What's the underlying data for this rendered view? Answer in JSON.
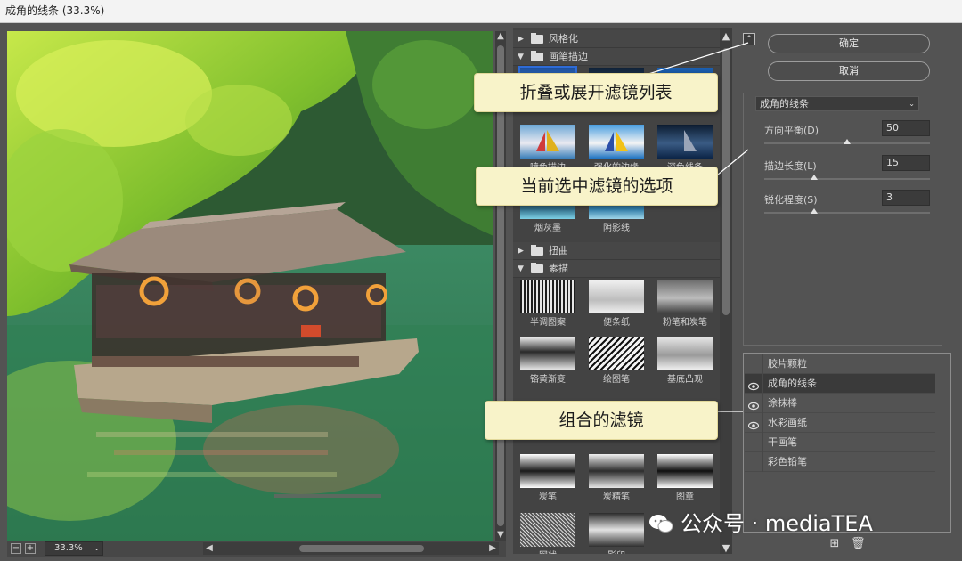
{
  "window": {
    "title": "成角的线条 (33.3%)"
  },
  "preview": {
    "zoom": "33.3%"
  },
  "gallery": {
    "categories": [
      {
        "label": "风格化",
        "expanded": false
      },
      {
        "label": "画笔描边",
        "expanded": true
      },
      {
        "label": "扭曲",
        "expanded": false
      },
      {
        "label": "素描",
        "expanded": true
      }
    ],
    "brush_thumbs": [
      "喷色描边",
      "强化的边缘",
      "深色线条",
      "烟灰墨",
      "阴影线"
    ],
    "sketch_thumbs": [
      "半调图案",
      "便条纸",
      "粉笔和炭笔",
      "铬黄渐变",
      "绘图笔",
      "基底凸现",
      "炭笔",
      "炭精笔",
      "图章",
      "网状",
      "影印"
    ]
  },
  "buttons": {
    "ok": "确定",
    "cancel": "取消"
  },
  "options": {
    "filter_name": "成角的线条",
    "params": [
      {
        "label": "方向平衡(D)",
        "value": "50",
        "fraction": 0.5
      },
      {
        "label": "描边长度(L)",
        "value": "15",
        "fraction": 0.3
      },
      {
        "label": "锐化程度(S)",
        "value": "3",
        "fraction": 0.3
      }
    ]
  },
  "layers": [
    {
      "name": "胶片颗粒",
      "visible": false
    },
    {
      "name": "成角的线条",
      "visible": true,
      "active": true
    },
    {
      "name": "涂抹棒",
      "visible": true
    },
    {
      "name": "水彩画纸",
      "visible": true
    },
    {
      "name": "干画笔",
      "visible": false
    },
    {
      "name": "彩色铅笔",
      "visible": false
    }
  ],
  "annotations": {
    "collapse": "折叠或展开滤镜列表",
    "options": "当前选中滤镜的选项",
    "combined": "组合的滤镜"
  },
  "watermark": "公众号 · mediaTEA",
  "colors": {
    "accent": "#2e6bd6",
    "callout_bg": "#f8f3c9"
  }
}
